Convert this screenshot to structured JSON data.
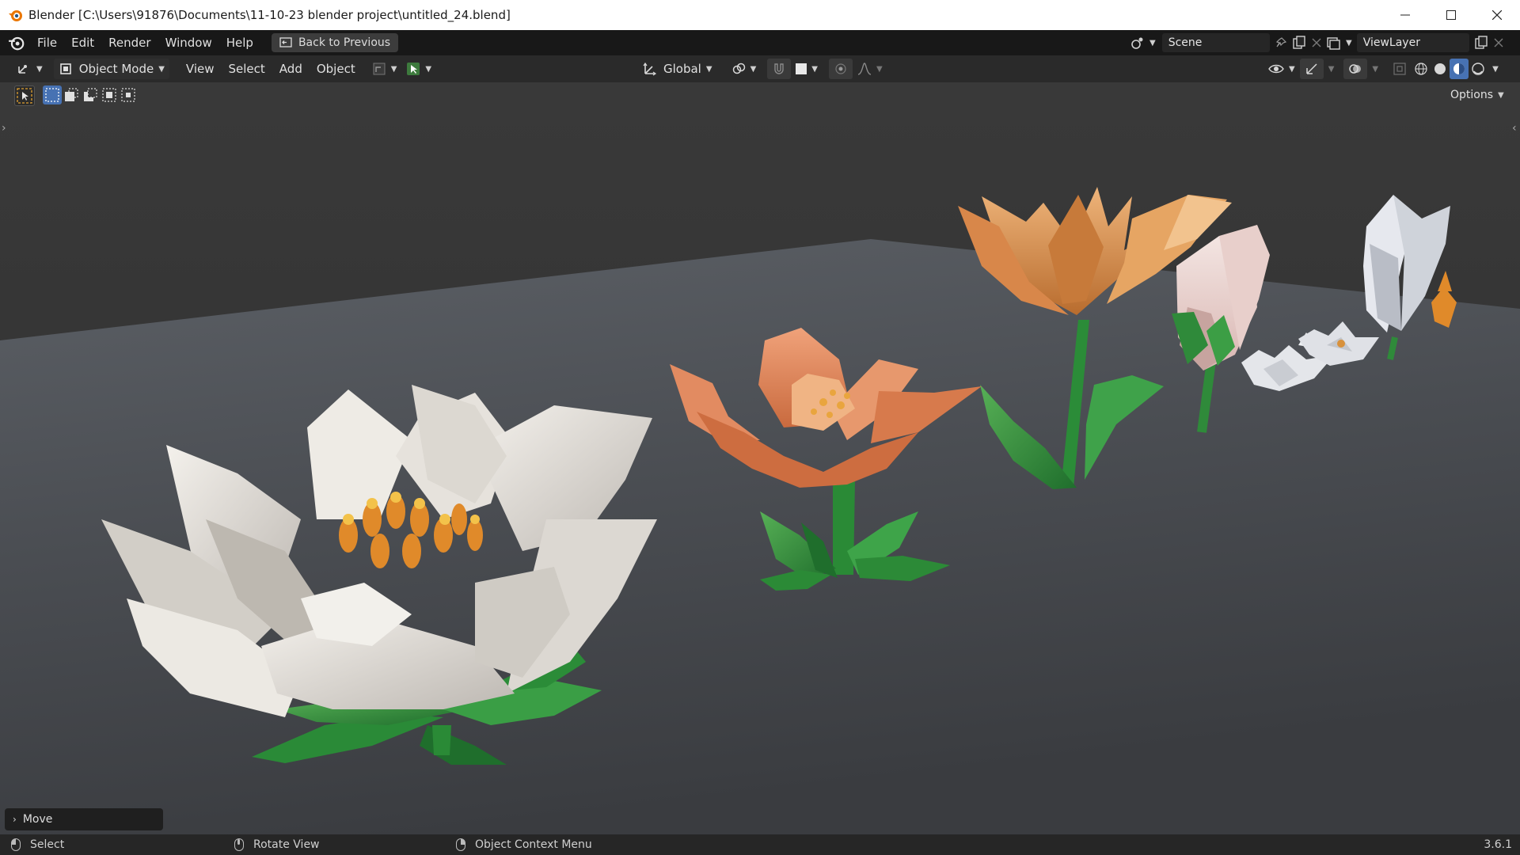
{
  "window": {
    "title": "Blender [C:\\Users\\91876\\Documents\\11-10-23 blender project\\untitled_24.blend]"
  },
  "topbar": {
    "menus": [
      "File",
      "Edit",
      "Render",
      "Window",
      "Help"
    ],
    "back_button": "Back to Previous",
    "scene": "Scene",
    "view_layer": "ViewLayer"
  },
  "view_header": {
    "mode": "Object Mode",
    "menus": [
      "View",
      "Select",
      "Add",
      "Object"
    ],
    "transform_orientation": "Global",
    "options_label": "Options"
  },
  "tool_panel": {
    "move_label": "Move"
  },
  "statusbar": {
    "select": "Select",
    "rotate_view": "Rotate View",
    "context_menu": "Object Context Menu",
    "version": "3.6.1"
  },
  "colors": {
    "accent_blue": "#4772b3",
    "viewport_bg": "#3a3d41",
    "header_bg": "#2a2a2a"
  }
}
